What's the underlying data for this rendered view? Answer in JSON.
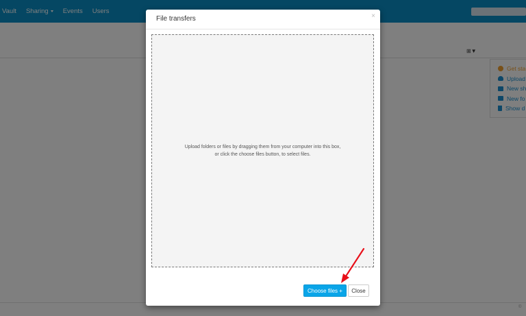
{
  "nav": {
    "items": [
      {
        "label": "Vault",
        "dropdown": false
      },
      {
        "label": "Sharing",
        "dropdown": true
      },
      {
        "label": "Events",
        "dropdown": false
      },
      {
        "label": "Users",
        "dropdown": false
      }
    ]
  },
  "view_toggle": {
    "icons": [
      "grid-icon",
      "filter-icon"
    ],
    "text": "⊞▼"
  },
  "side_panel": {
    "items": [
      {
        "label": "Get sta",
        "icon": "plus-circle-icon",
        "color": "#f0a030"
      },
      {
        "label": "Upload",
        "icon": "cloud-upload-icon",
        "color": "#1a8fd0"
      },
      {
        "label": "New sh",
        "icon": "shared-folder-icon",
        "color": "#1a8fd0"
      },
      {
        "label": "New fo",
        "icon": "folder-icon",
        "color": "#1a8fd0"
      },
      {
        "label": "Show d",
        "icon": "trash-icon",
        "color": "#1a8fd0"
      }
    ]
  },
  "footer": {
    "mark": "©"
  },
  "modal": {
    "title": "File transfers",
    "close_glyph": "×",
    "dropzone": {
      "line1": "Upload folders or files by dragging them from your computer into this box,",
      "line2": "or click the choose files button, to select files."
    },
    "buttons": {
      "choose_label": "Choose files +",
      "close_label": "Close"
    }
  },
  "colors": {
    "brand": "#0a8fc6",
    "primary_button": "#0aa5e8",
    "annotation_arrow": "#e8101a"
  }
}
